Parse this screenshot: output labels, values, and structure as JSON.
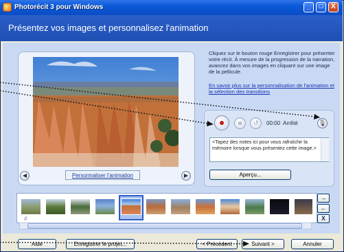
{
  "window": {
    "title": "Photorécit 3 pour Windows",
    "buttons": {
      "minimize": "_",
      "maximize": "□",
      "close": "X"
    }
  },
  "page": {
    "heading": "Présentez vos images et personnalisez l'animation"
  },
  "preview": {
    "customize_button": "Personnaliser l'animation",
    "prev_icon": "left-arrow",
    "next_icon": "right-arrow"
  },
  "instructions": {
    "text": "Cliquez sur le bouton rouge Enregistrer pour présenter votre récit. À mesure de la progression de la narration, avancez dans vos images en cliquant sur une image de la pellicule.",
    "link": "En savoir plus sur la personnalisation de l'animation et la sélection des transitions"
  },
  "narration": {
    "time": "00:00",
    "status": "Arrêté",
    "notes_placeholder": "<Tapez des notes ici pour vous rafraîchir la mémoire lorsque vous présentez cette image.>",
    "preview_button": "Aperçu..."
  },
  "filmstrip": {
    "selected_index": 5,
    "thumbnails": [
      "thumb1",
      "thumb2",
      "thumb3",
      "thumb4",
      "thumb5",
      "thumb6",
      "thumb7",
      "thumb8",
      "thumb9",
      "thumb10",
      "thumb11",
      "thumb12"
    ],
    "side_buttons": {
      "right": "→",
      "left": "←",
      "remove": "X"
    }
  },
  "footer": {
    "help": "Aide",
    "save_project": "Enregistrer le projet...",
    "previous": "< Précédent",
    "next": "Suivant >",
    "cancel": "Annuler"
  }
}
